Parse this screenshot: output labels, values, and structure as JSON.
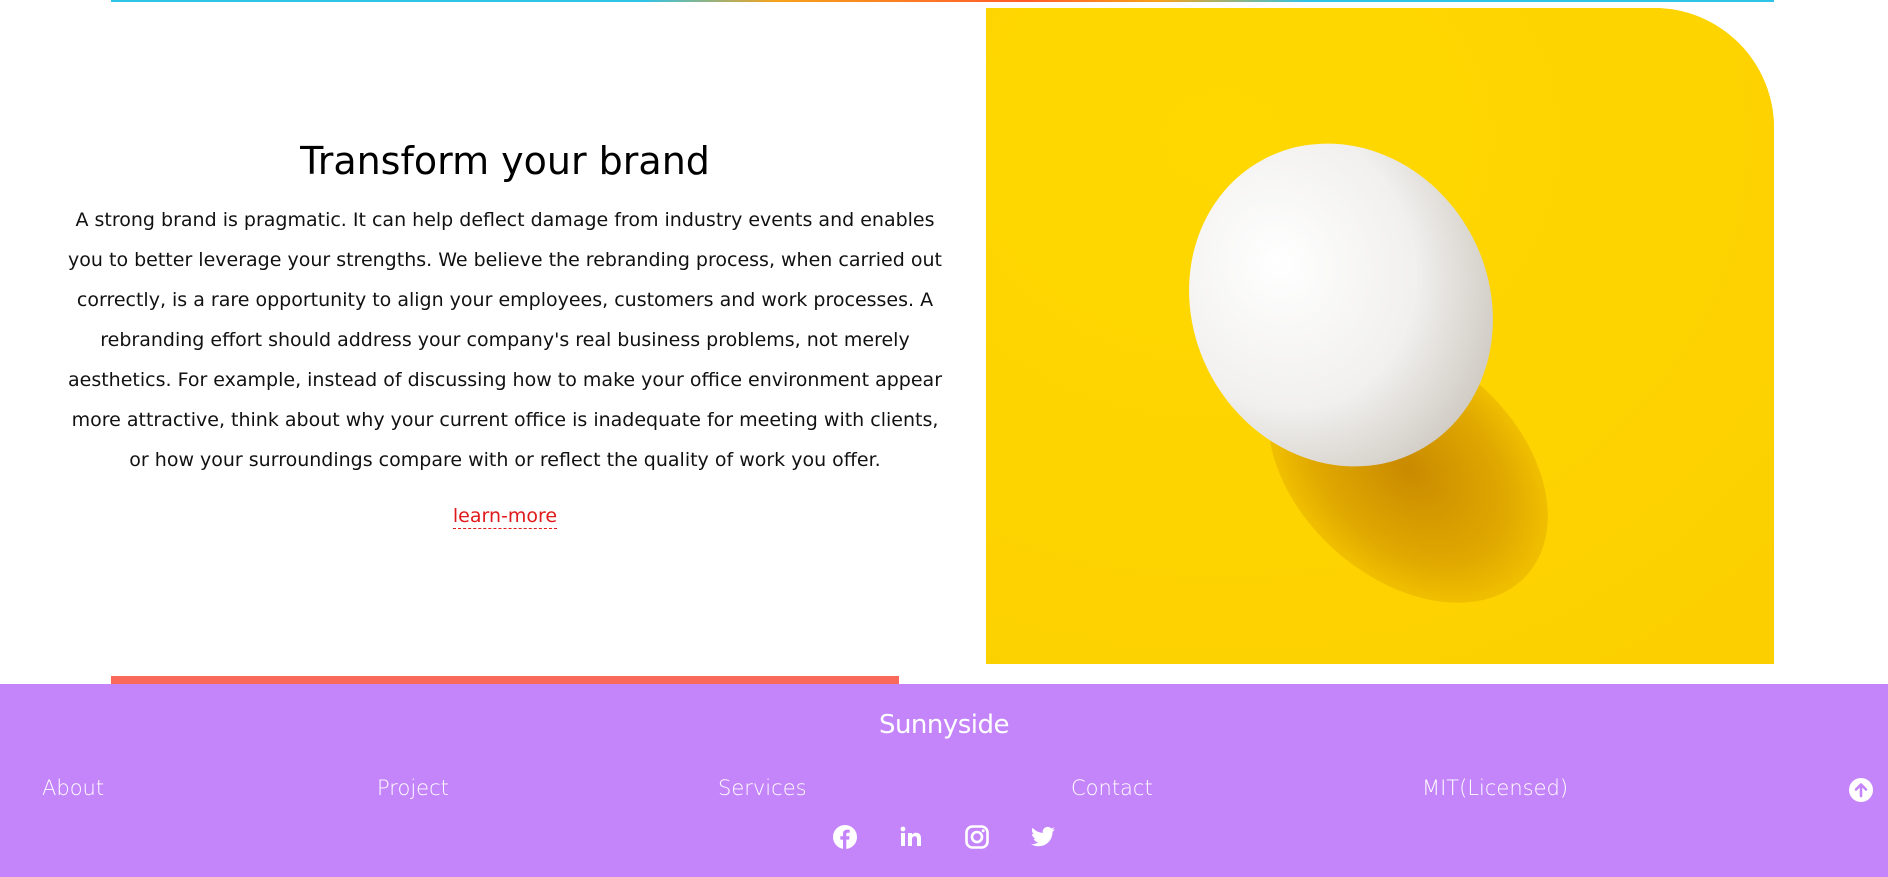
{
  "section": {
    "heading": "Transform your brand",
    "body": "A strong brand is pragmatic. It can help deflect damage from industry events and enables you to better leverage your strengths. We believe the rebranding process, when carried out correctly, is a rare opportunity to align your employees, customers and work processes. A rebranding effort should address your company's real business problems, not merely aesthetics. For example, instead of discussing how to make your office environment appear more attractive, think about why your current office is inadequate for meeting with clients, or how your surroundings compare with or reflect the quality of work you offer.",
    "link_label": "learn-more",
    "link_color": "#e01a1a",
    "image_icon": "egg-photo",
    "image_background": "#fdd300"
  },
  "footer": {
    "background": "#c585fa",
    "brand": "Sunnyside",
    "nav": [
      "About",
      "Project",
      "Services",
      "Contact",
      "MIT(Licensed)"
    ],
    "back_to_top_icon": "arrow-up-circle-icon",
    "socials": [
      "facebook-icon",
      "linkedin-icon",
      "instagram-icon",
      "twitter-icon"
    ]
  },
  "colors": {
    "accent_bar": "#f96a5a",
    "top_stripe": "#2fc3e8"
  }
}
